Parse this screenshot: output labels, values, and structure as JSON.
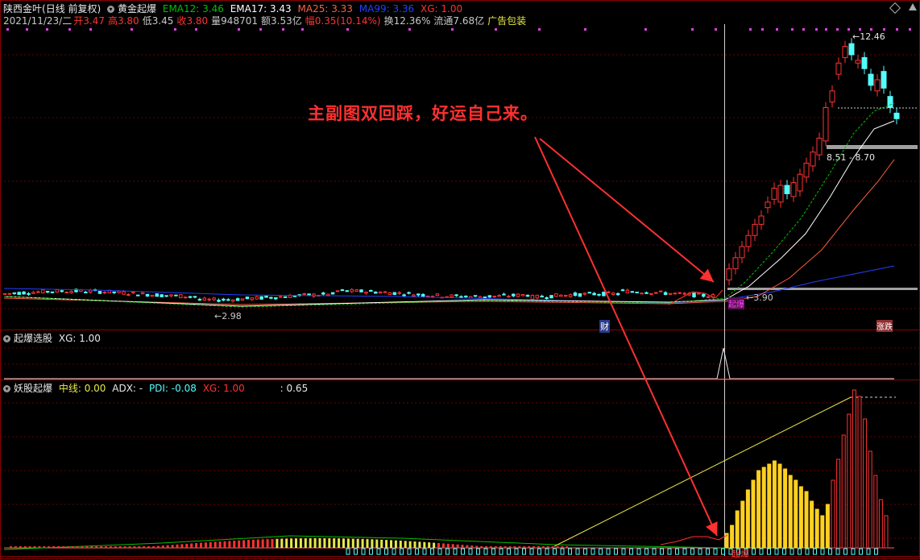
{
  "header": {
    "stock_name": "陕西金叶",
    "period": "(日线 前复权)",
    "indicator": "黄金起爆",
    "ema12": "EMA12: 3.46",
    "ema17": "EMA17: 3.43",
    "ma25": "MA25: 3.33",
    "ma99": "MA99: 3.36",
    "xg": "XG: 1.00",
    "date": "2021/11/23/二",
    "open_label": "开",
    "open": "3.47",
    "high_label": "高",
    "high": "3.80",
    "low_label": "低",
    "low": "3.45",
    "close_label": "收",
    "close": "3.80",
    "vol_label": "量",
    "vol": "948701",
    "amount_label": "额",
    "amount": "3.53亿",
    "chg_label": "幅",
    "chg": "0.35(10.14%)",
    "turnover_label": "换",
    "turnover": "12.36%",
    "float_label": "流通",
    "float": "7.68亿",
    "ad": "广告包装"
  },
  "main_labels": {
    "low_mark": "2.98",
    "start_mark": "3.90",
    "range_mark": "8.51 - 8.70",
    "high_mark": "12.46",
    "cai": "财",
    "badge1": "起爆",
    "zt": "涨跌",
    "qi": "起",
    "qibao": "起爆"
  },
  "panel2": {
    "title": "起爆选股",
    "xg": "XG: 1.00"
  },
  "panel3": {
    "title": "妖股起爆",
    "mid": "中线: 0.00",
    "adx": "ADX: -",
    "pdi": "PDI: -0.08",
    "xg": "XG: 1.00",
    "extra": ": 0.65"
  },
  "annotation": "主副图双回踩，好运自己来。",
  "colors": {
    "up": "#ff3232",
    "down": "#54fcfc",
    "ema12": "#ffffff",
    "ema17": "#00c000",
    "ma25": "#ff6040",
    "ma99": "#2040ff",
    "annot": "#ff3030",
    "border": "#8b0000"
  },
  "chart_data": {
    "type": "candlestick",
    "key_prices": {
      "low": 2.98,
      "breakout": 3.9,
      "resistance": [
        8.51,
        8.7
      ],
      "high": 12.46
    }
  }
}
